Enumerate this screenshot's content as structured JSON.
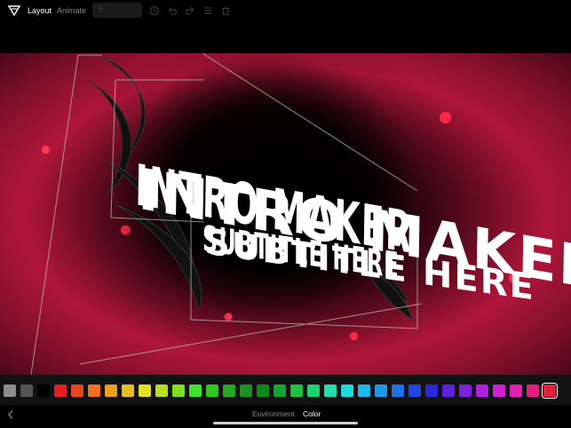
{
  "toolbar": {
    "tabs": [
      {
        "label": "Layout",
        "active": true
      },
      {
        "label": "Animate",
        "active": false
      }
    ],
    "add_label": "+",
    "icons": [
      "app-logo-icon",
      "add-icon",
      "history-icon",
      "undo-icon",
      "redo-icon",
      "menu-icon",
      "trash-icon"
    ]
  },
  "canvas": {
    "title_text": "INTRO MAKER",
    "subtitle_text": "SUBTITLE HERE",
    "background_color": "#b0163a"
  },
  "palette": {
    "swatches": [
      "#8c8c8c",
      "#555555",
      "#000000",
      "#e02020",
      "#e8461c",
      "#f07020",
      "#e8a020",
      "#e8c020",
      "#e0e020",
      "#b8e020",
      "#80e020",
      "#40e030",
      "#30c820",
      "#28a820",
      "#209020",
      "#108818",
      "#18a030",
      "#20c040",
      "#20d070",
      "#20e0b0",
      "#20d8e0",
      "#20b8e8",
      "#2098e8",
      "#2070e8",
      "#2048e0",
      "#2828d8",
      "#6020e0",
      "#8020e0",
      "#b020e0",
      "#d020d0",
      "#e020b0",
      "#e02080",
      "#e0203c"
    ],
    "selected_index": 32
  },
  "bottom_tabs": [
    {
      "label": "Environment",
      "active": false
    },
    {
      "label": "Color",
      "active": true
    }
  ]
}
